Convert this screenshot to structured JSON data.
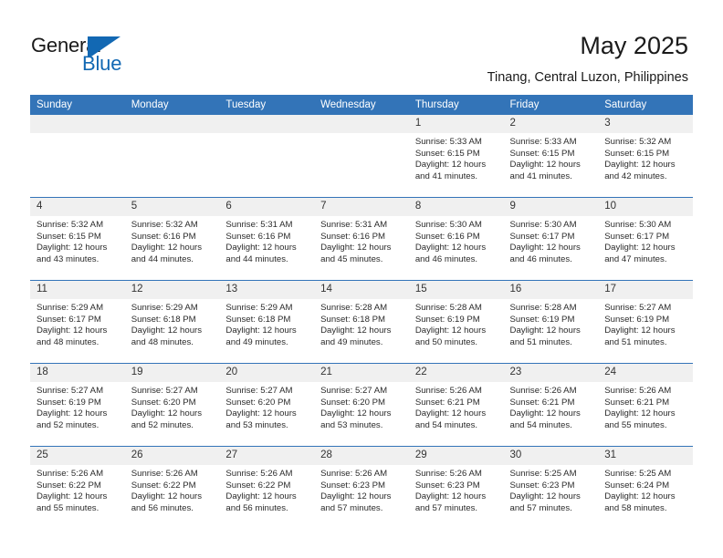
{
  "brand": {
    "word1": "General",
    "word2": "Blue",
    "mark": "triangle-logo",
    "color_primary": "#1268b3"
  },
  "header": {
    "title": "May 2025",
    "subtitle": "Tinang, Central Luzon, Philippines"
  },
  "theme": {
    "header_row_bg": "#3374b8",
    "daynum_bg": "#f0f0f0",
    "grid_line": "#3374b8",
    "text": "#2b2b2b"
  },
  "weekdays": [
    "Sunday",
    "Monday",
    "Tuesday",
    "Wednesday",
    "Thursday",
    "Friday",
    "Saturday"
  ],
  "weeks": [
    [
      {
        "day": "",
        "sunrise": "",
        "sunset": "",
        "daylight1": "",
        "daylight2": "",
        "empty": true
      },
      {
        "day": "",
        "sunrise": "",
        "sunset": "",
        "daylight1": "",
        "daylight2": "",
        "empty": true
      },
      {
        "day": "",
        "sunrise": "",
        "sunset": "",
        "daylight1": "",
        "daylight2": "",
        "empty": true
      },
      {
        "day": "",
        "sunrise": "",
        "sunset": "",
        "daylight1": "",
        "daylight2": "",
        "empty": true
      },
      {
        "day": "1",
        "sunrise": "Sunrise: 5:33 AM",
        "sunset": "Sunset: 6:15 PM",
        "daylight1": "Daylight: 12 hours",
        "daylight2": "and 41 minutes."
      },
      {
        "day": "2",
        "sunrise": "Sunrise: 5:33 AM",
        "sunset": "Sunset: 6:15 PM",
        "daylight1": "Daylight: 12 hours",
        "daylight2": "and 41 minutes."
      },
      {
        "day": "3",
        "sunrise": "Sunrise: 5:32 AM",
        "sunset": "Sunset: 6:15 PM",
        "daylight1": "Daylight: 12 hours",
        "daylight2": "and 42 minutes."
      }
    ],
    [
      {
        "day": "4",
        "sunrise": "Sunrise: 5:32 AM",
        "sunset": "Sunset: 6:15 PM",
        "daylight1": "Daylight: 12 hours",
        "daylight2": "and 43 minutes."
      },
      {
        "day": "5",
        "sunrise": "Sunrise: 5:32 AM",
        "sunset": "Sunset: 6:16 PM",
        "daylight1": "Daylight: 12 hours",
        "daylight2": "and 44 minutes."
      },
      {
        "day": "6",
        "sunrise": "Sunrise: 5:31 AM",
        "sunset": "Sunset: 6:16 PM",
        "daylight1": "Daylight: 12 hours",
        "daylight2": "and 44 minutes."
      },
      {
        "day": "7",
        "sunrise": "Sunrise: 5:31 AM",
        "sunset": "Sunset: 6:16 PM",
        "daylight1": "Daylight: 12 hours",
        "daylight2": "and 45 minutes."
      },
      {
        "day": "8",
        "sunrise": "Sunrise: 5:30 AM",
        "sunset": "Sunset: 6:16 PM",
        "daylight1": "Daylight: 12 hours",
        "daylight2": "and 46 minutes."
      },
      {
        "day": "9",
        "sunrise": "Sunrise: 5:30 AM",
        "sunset": "Sunset: 6:17 PM",
        "daylight1": "Daylight: 12 hours",
        "daylight2": "and 46 minutes."
      },
      {
        "day": "10",
        "sunrise": "Sunrise: 5:30 AM",
        "sunset": "Sunset: 6:17 PM",
        "daylight1": "Daylight: 12 hours",
        "daylight2": "and 47 minutes."
      }
    ],
    [
      {
        "day": "11",
        "sunrise": "Sunrise: 5:29 AM",
        "sunset": "Sunset: 6:17 PM",
        "daylight1": "Daylight: 12 hours",
        "daylight2": "and 48 minutes."
      },
      {
        "day": "12",
        "sunrise": "Sunrise: 5:29 AM",
        "sunset": "Sunset: 6:18 PM",
        "daylight1": "Daylight: 12 hours",
        "daylight2": "and 48 minutes."
      },
      {
        "day": "13",
        "sunrise": "Sunrise: 5:29 AM",
        "sunset": "Sunset: 6:18 PM",
        "daylight1": "Daylight: 12 hours",
        "daylight2": "and 49 minutes."
      },
      {
        "day": "14",
        "sunrise": "Sunrise: 5:28 AM",
        "sunset": "Sunset: 6:18 PM",
        "daylight1": "Daylight: 12 hours",
        "daylight2": "and 49 minutes."
      },
      {
        "day": "15",
        "sunrise": "Sunrise: 5:28 AM",
        "sunset": "Sunset: 6:19 PM",
        "daylight1": "Daylight: 12 hours",
        "daylight2": "and 50 minutes."
      },
      {
        "day": "16",
        "sunrise": "Sunrise: 5:28 AM",
        "sunset": "Sunset: 6:19 PM",
        "daylight1": "Daylight: 12 hours",
        "daylight2": "and 51 minutes."
      },
      {
        "day": "17",
        "sunrise": "Sunrise: 5:27 AM",
        "sunset": "Sunset: 6:19 PM",
        "daylight1": "Daylight: 12 hours",
        "daylight2": "and 51 minutes."
      }
    ],
    [
      {
        "day": "18",
        "sunrise": "Sunrise: 5:27 AM",
        "sunset": "Sunset: 6:19 PM",
        "daylight1": "Daylight: 12 hours",
        "daylight2": "and 52 minutes."
      },
      {
        "day": "19",
        "sunrise": "Sunrise: 5:27 AM",
        "sunset": "Sunset: 6:20 PM",
        "daylight1": "Daylight: 12 hours",
        "daylight2": "and 52 minutes."
      },
      {
        "day": "20",
        "sunrise": "Sunrise: 5:27 AM",
        "sunset": "Sunset: 6:20 PM",
        "daylight1": "Daylight: 12 hours",
        "daylight2": "and 53 minutes."
      },
      {
        "day": "21",
        "sunrise": "Sunrise: 5:27 AM",
        "sunset": "Sunset: 6:20 PM",
        "daylight1": "Daylight: 12 hours",
        "daylight2": "and 53 minutes."
      },
      {
        "day": "22",
        "sunrise": "Sunrise: 5:26 AM",
        "sunset": "Sunset: 6:21 PM",
        "daylight1": "Daylight: 12 hours",
        "daylight2": "and 54 minutes."
      },
      {
        "day": "23",
        "sunrise": "Sunrise: 5:26 AM",
        "sunset": "Sunset: 6:21 PM",
        "daylight1": "Daylight: 12 hours",
        "daylight2": "and 54 minutes."
      },
      {
        "day": "24",
        "sunrise": "Sunrise: 5:26 AM",
        "sunset": "Sunset: 6:21 PM",
        "daylight1": "Daylight: 12 hours",
        "daylight2": "and 55 minutes."
      }
    ],
    [
      {
        "day": "25",
        "sunrise": "Sunrise: 5:26 AM",
        "sunset": "Sunset: 6:22 PM",
        "daylight1": "Daylight: 12 hours",
        "daylight2": "and 55 minutes."
      },
      {
        "day": "26",
        "sunrise": "Sunrise: 5:26 AM",
        "sunset": "Sunset: 6:22 PM",
        "daylight1": "Daylight: 12 hours",
        "daylight2": "and 56 minutes."
      },
      {
        "day": "27",
        "sunrise": "Sunrise: 5:26 AM",
        "sunset": "Sunset: 6:22 PM",
        "daylight1": "Daylight: 12 hours",
        "daylight2": "and 56 minutes."
      },
      {
        "day": "28",
        "sunrise": "Sunrise: 5:26 AM",
        "sunset": "Sunset: 6:23 PM",
        "daylight1": "Daylight: 12 hours",
        "daylight2": "and 57 minutes."
      },
      {
        "day": "29",
        "sunrise": "Sunrise: 5:26 AM",
        "sunset": "Sunset: 6:23 PM",
        "daylight1": "Daylight: 12 hours",
        "daylight2": "and 57 minutes."
      },
      {
        "day": "30",
        "sunrise": "Sunrise: 5:25 AM",
        "sunset": "Sunset: 6:23 PM",
        "daylight1": "Daylight: 12 hours",
        "daylight2": "and 57 minutes."
      },
      {
        "day": "31",
        "sunrise": "Sunrise: 5:25 AM",
        "sunset": "Sunset: 6:24 PM",
        "daylight1": "Daylight: 12 hours",
        "daylight2": "and 58 minutes."
      }
    ]
  ]
}
